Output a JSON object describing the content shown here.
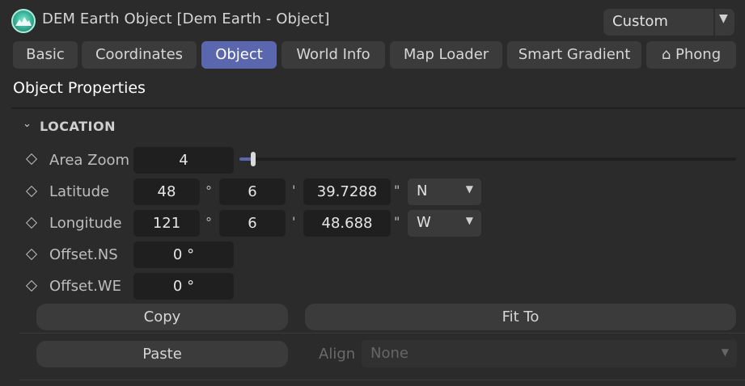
{
  "window": {
    "title": "DEM Earth Object [Dem Earth - Object]",
    "preset_value": "Custom"
  },
  "tabs": [
    {
      "label": "Basic"
    },
    {
      "label": "Coordinates"
    },
    {
      "label": "Object",
      "active": true
    },
    {
      "label": "World Info"
    },
    {
      "label": "Map Loader"
    },
    {
      "label": "Smart Gradient"
    },
    {
      "label": "⌂ Phong"
    }
  ],
  "section": {
    "title": "Object Properties"
  },
  "group": {
    "title": "LOCATION",
    "expanded": true
  },
  "fields": {
    "area_zoom": {
      "label": "Area Zoom",
      "value": "4",
      "slider_fraction": 0.02
    },
    "latitude": {
      "label": "Latitude",
      "deg": "48",
      "min": "6",
      "sec": "39.7288",
      "hemisphere": "N"
    },
    "longitude": {
      "label": "Longitude",
      "deg": "121",
      "min": "6",
      "sec": "48.688",
      "hemisphere": "W"
    },
    "offset_ns": {
      "label": "Offset.NS",
      "value": "0 °"
    },
    "offset_we": {
      "label": "Offset.WE",
      "value": "0 °"
    }
  },
  "units": {
    "deg": "°",
    "min": "'",
    "sec": "\""
  },
  "buttons": {
    "copy": "Copy",
    "fit_to": "Fit To",
    "paste": "Paste"
  },
  "align": {
    "label": "Align",
    "value": "None"
  },
  "colors": {
    "accent": "#5a67ae",
    "background": "#2b2b2b",
    "field": "#1f1f1f",
    "button": "#3b3b3b"
  },
  "icons": {
    "app": "dem-earth-icon",
    "keyframe": "diamond-icon",
    "dropdown": "chevron-down-icon"
  }
}
